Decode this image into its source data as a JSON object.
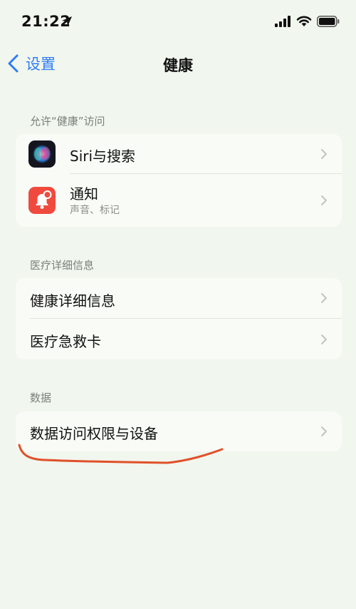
{
  "status_bar": {
    "time": "21:22",
    "icons": [
      "location-arrow-icon",
      "cellular-signal-icon",
      "wifi-icon",
      "battery-icon"
    ]
  },
  "nav": {
    "back_label": "设置",
    "title": "健康"
  },
  "sections": {
    "access": {
      "header": "允许“健康”访问",
      "items": [
        {
          "label": "Siri与搜索",
          "icon": "siri-icon"
        },
        {
          "label": "通知",
          "subtitle": "声音、标记",
          "icon": "notification-icon"
        }
      ]
    },
    "medical": {
      "header": "医疗详细信息",
      "items": [
        {
          "label": "健康详细信息"
        },
        {
          "label": "医疗急救卡"
        }
      ]
    },
    "data": {
      "header": "数据",
      "items": [
        {
          "label": "数据访问权限与设备"
        }
      ]
    }
  },
  "colors": {
    "background": "#f1f6ee",
    "accent": "#2f7cf6",
    "annotation": "#e0502a"
  }
}
